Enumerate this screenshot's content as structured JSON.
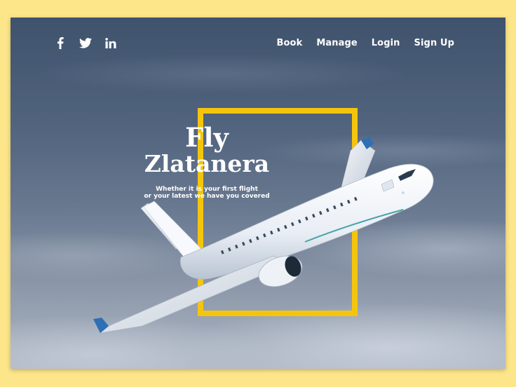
{
  "social": {
    "facebook": "facebook-icon",
    "twitter": "twitter-icon",
    "linkedin": "linkedin-icon"
  },
  "nav": {
    "items": [
      "Book",
      "Manage",
      "Login",
      "Sign Up"
    ]
  },
  "hero": {
    "title_line1": "Fly",
    "title_line2": "Zlatanera",
    "subtitle_line1": "Whether it is your first flight",
    "subtitle_line2": "or your latest we have you covered"
  },
  "colors": {
    "background": "#fde68a",
    "accent": "#f5c50d",
    "text": "#ffffff"
  }
}
